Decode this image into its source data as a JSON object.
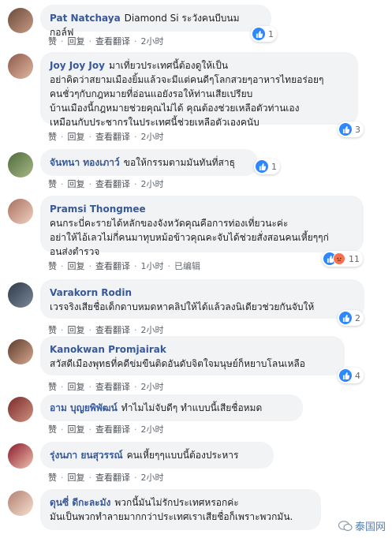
{
  "actions": {
    "like": "赞",
    "reply": "回复",
    "translate": "查看翻译"
  },
  "comments": [
    {
      "name": "Pat Natchaya",
      "text": "Diamond Si ระวังคนบีบนมกอล์ฟ",
      "reacts": "1",
      "time": "2小时",
      "edited": ""
    },
    {
      "name": "Joy Joy Joy",
      "text": "มาเที่ยวประเทศนี้ต้องดูให้เป็น\nอย่าคิดว่าสยามเมืองยิ้มแล้วจะมีแต่คนดีๆโลกสวยๆอาหารไทยอร่อยๆ\nคนชั่วๆกับกฎหมายที่อ่อนแอยังรอให้ท่านเสียเปรียบ\nบ้านเมืองนี้กฎหมายช่วยคุณไม่ได้ คุณต้องช่วยเหลือตัวท่านเอง\nเหมือนกับประชากรในประเทศนี้ช่วยเหลือตัวเองคนับ",
      "reacts": "3",
      "time": "2小时",
      "edited": ""
    },
    {
      "name": "จันทนา ทองเภาว์",
      "text": "ขอให้กรรมตามมันทันที่สาธุ",
      "reacts": "1",
      "time": "2小时",
      "edited": ""
    },
    {
      "name": "Pramsi Thongmee",
      "text": "คนกระบี่คะรายได้หลักของจังหวัดคุณคือการท่องเที่ยวนะค่ะ\nอย่าให้ไอ้เลวไม่กี่คนมาทุบหม้อข้าวคุณคะจับได้ช่วยสั่งสอนคนเหี้ยๆๆก่\nอนส่งตำรวจ",
      "reacts": "11",
      "time": "1小时",
      "edited": "已编辑"
    },
    {
      "name": "Varakorn Rodin",
      "text": "เวรจริงเสียชื่อเด็กดาบหมดหาคลิปให้ได้แล้วลงนิเดียวช่วยกันจับให้",
      "reacts": "2",
      "time": "2小时",
      "edited": ""
    },
    {
      "name": "Kanokwan Promjairak",
      "text": "สวัสดีเมืองพุทธที่คดีข่มขืนติดอันดับจิตใจมนุษย์ก็หยาบโลนเหลือ",
      "reacts": "4",
      "time": "2小时",
      "edited": ""
    },
    {
      "name": "อาม บุญยพิพัฒน์",
      "text": "ทำไมไม่จับดีๆ ทำแบบนี้เสียชื่อหมด",
      "reacts": "",
      "time": "2小时",
      "edited": ""
    },
    {
      "name": "รุ่งนภา ยนสุวรรณ์",
      "text": "คนเหี้ยๆๆแบบนี้ต้องประหาร",
      "reacts": "",
      "time": "2小时",
      "edited": ""
    },
    {
      "name": "ดุนซี่ ดีกะละมัง",
      "text": "พวกนี้มันไม่รักประเทศหรอกค่ะ\nมันเป็นพวกทำลายมากกว่าประเทศเราเสียชื่อก็เพราะพวกมัน.",
      "reacts": "",
      "time": "",
      "edited": ""
    }
  ],
  "watermark": "泰国网",
  "colors": {
    "name": "#385898",
    "bubble": "#f2f3f5",
    "like": "#2d88ff",
    "angry": "#f7714b"
  }
}
